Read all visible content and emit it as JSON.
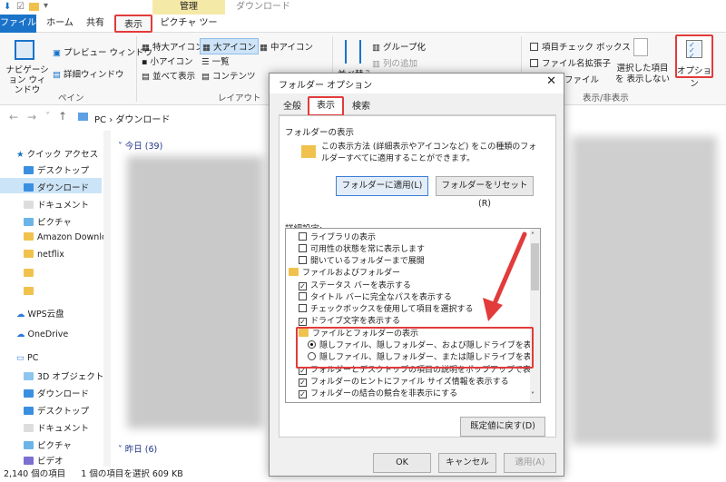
{
  "ribbon_tabs": {
    "file": "ファイル",
    "home": "ホーム",
    "share": "共有",
    "view": "表示",
    "picture_tools": "ピクチャ ツール"
  },
  "context": {
    "manage": "管理",
    "title": "ダウンロード"
  },
  "ribbon": {
    "nav_pane": "ナビゲーション ウィンドウ",
    "preview": "プレビュー ウィンドウ",
    "details": "詳細ウィンドウ",
    "pane_group": "ペイン",
    "xl_icons": "特大アイコン",
    "l_icons": "大アイコン",
    "m_icons": "中アイコン",
    "s_icons": "小アイコン",
    "list": "一覧",
    "tiles": "並べて表示",
    "content": "コンテンツ",
    "layout_group": "レイアウト",
    "group_by": "グループ化",
    "add_col": "列の追加",
    "sort": "並べ替え",
    "item_cb": "項目チェック ボックス",
    "file_ext": "ファイル名拡張子",
    "hidden": "ファイル",
    "hide_sel": "選択した項目を 表示しない",
    "show_hide_group": "表示/非表示",
    "options": "オプション"
  },
  "address": {
    "path": "PC › ダウンロード"
  },
  "nav": {
    "quick": "クイック アクセス",
    "desktop": "デスクトップ",
    "download": "ダウンロード",
    "docs": "ドキュメント",
    "pics": "ピクチャ",
    "amazon": "Amazon Downlo",
    "netflix": "netflix",
    "wps": "WPS云盘",
    "onedrive": "OneDrive",
    "pc": "PC",
    "obj3d": "3D オブジェクト",
    "download2": "ダウンロード",
    "desktop2": "デスクトップ",
    "docs2": "ドキュメント",
    "pics2": "ピクチャ",
    "video": "ビデオ"
  },
  "groups": {
    "today": "今日 (39)",
    "yesterday": "昨日 (6)"
  },
  "status": {
    "count": "2,140 個の項目",
    "selected": "1 個の項目を選択  609 KB"
  },
  "dialog": {
    "title": "フォルダー オプション",
    "close": "✕",
    "tabs": {
      "general": "全般",
      "view": "表示",
      "search": "検索"
    },
    "folder_views": "フォルダーの表示",
    "folder_views_desc": "この表示方法 (詳細表示やアイコンなど) をこの種類のフォルダーすべてに適用することができます。",
    "apply": "フォルダーに適用(L)",
    "reset": "フォルダーをリセット(R)",
    "advanced": "詳細設定:",
    "items": [
      "ライブラリの表示",
      "可用性の状態を常に表示します",
      "開いているフォルダーまで展開",
      "ファイルおよびフォルダー",
      "ステータス バーを表示する",
      "タイトル バーに完全なパスを表示する",
      "チェックボックスを使用して項目を選択する",
      "ドライブ文字を表示する",
      "ファイルとフォルダーの表示",
      "隠しファイル、隠しフォルダー、および隠しドライブを表示する",
      "隠しファイル、隠しフォルダー、または隠しドライブを表示しない",
      "フォルダーとデスクトップの項目の説明をポップアップで表示する",
      "フォルダーのヒントにファイル サイズ情報を表示する",
      "フォルダーの結合の競合を非表示にする"
    ],
    "restore": "既定値に戻す(D)",
    "ok": "OK",
    "cancel": "キャンセル",
    "applyb": "適用(A)"
  },
  "colors": {
    "accent": "#1a73c9",
    "highlight": "#e23b3b"
  }
}
